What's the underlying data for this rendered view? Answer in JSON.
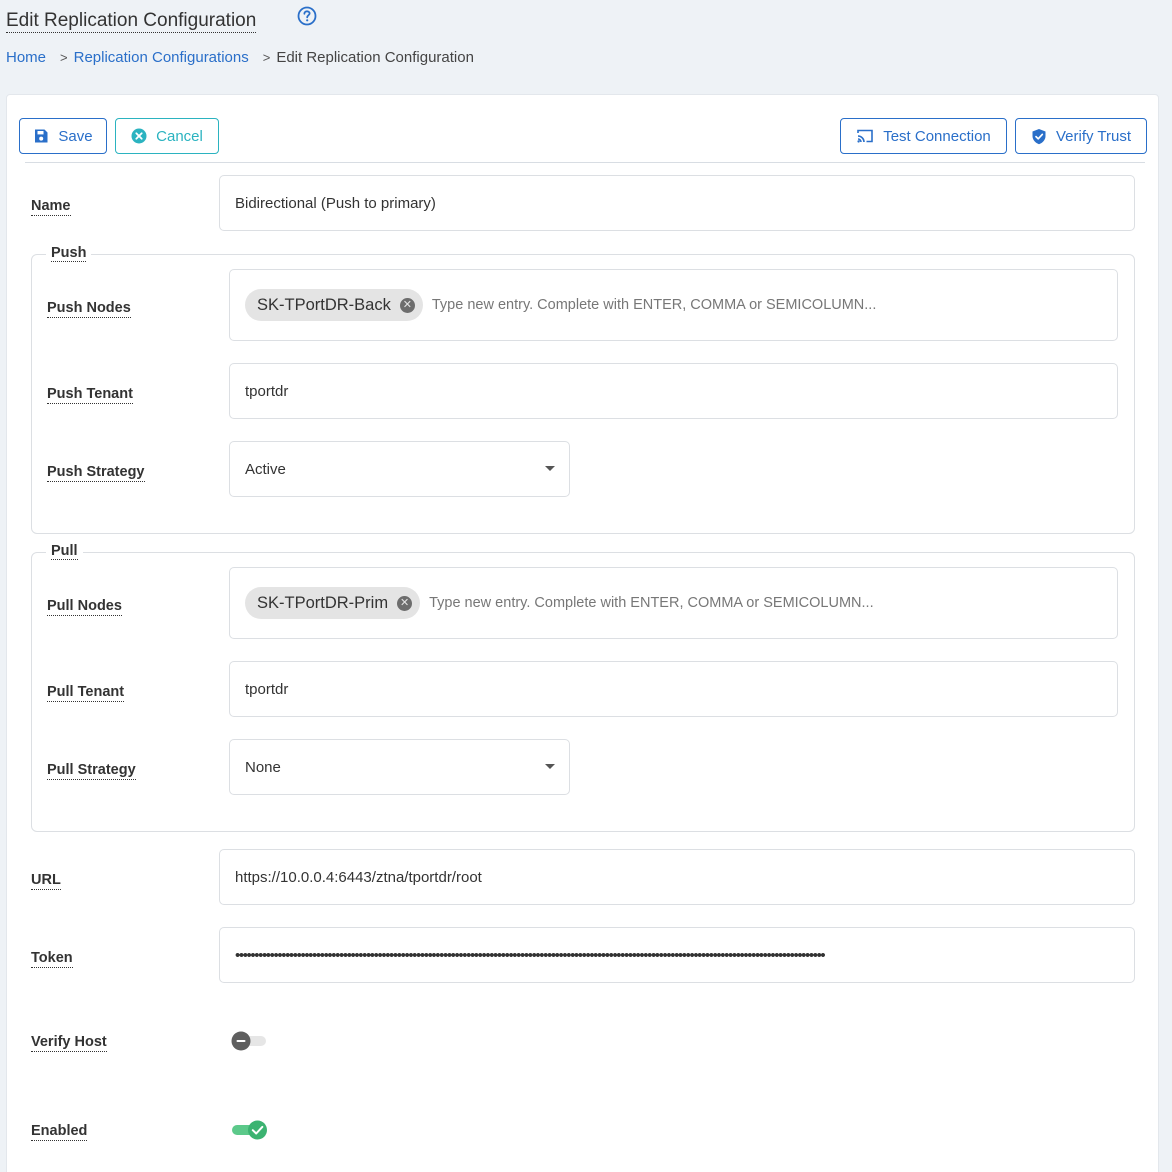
{
  "page": {
    "title": "Edit Replication Configuration"
  },
  "breadcrumb": {
    "home": "Home",
    "parent": "Replication Configurations",
    "current": "Edit Replication Configuration",
    "separator": ">"
  },
  "toolbar": {
    "save_label": "Save",
    "cancel_label": "Cancel",
    "test_connection_label": "Test Connection",
    "verify_trust_label": "Verify Trust"
  },
  "form": {
    "name": {
      "label": "Name",
      "value": "Bidirectional (Push to primary)"
    },
    "push": {
      "legend": "Push",
      "nodes_label": "Push Nodes",
      "nodes": [
        "SK-TPortDR-Back"
      ],
      "nodes_placeholder": "Type new entry. Complete with ENTER, COMMA or SEMICOLUMN...",
      "tenant_label": "Push Tenant",
      "tenant_value": "tportdr",
      "strategy_label": "Push Strategy",
      "strategy_value": "Active"
    },
    "pull": {
      "legend": "Pull",
      "nodes_label": "Pull Nodes",
      "nodes": [
        "SK-TPortDR-Prim"
      ],
      "nodes_placeholder": "Type new entry. Complete with ENTER, COMMA or SEMICOLUMN...",
      "tenant_label": "Pull Tenant",
      "tenant_value": "tportdr",
      "strategy_label": "Pull Strategy",
      "strategy_value": "None"
    },
    "url": {
      "label": "URL",
      "value": "https://10.0.0.4:6443/ztna/tportdr/root"
    },
    "token": {
      "label": "Token",
      "value": "•••••••••••••••••••••••••••••••••••••••••••••••••••••••••••••••••••••••••••••••••••••••••••••••••••••••••••••••••••••••••••••••••••••••••••••••••••••••••"
    },
    "verify_host": {
      "label": "Verify Host",
      "enabled": false
    },
    "enabled": {
      "label": "Enabled",
      "enabled": true
    }
  },
  "colors": {
    "primary": "#2a6fc9",
    "cancel": "#2bb3c0",
    "toggle_on": "#3cb371",
    "toggle_off": "#5f5f5f"
  },
  "icons": {
    "help": "help-circle-icon",
    "save": "floppy-disk-icon",
    "cancel": "close-circle-icon",
    "test_connection": "cast-icon",
    "verify_trust": "shield-check-icon",
    "chip_remove": "close-circle-icon",
    "dropdown": "caret-down-icon"
  }
}
